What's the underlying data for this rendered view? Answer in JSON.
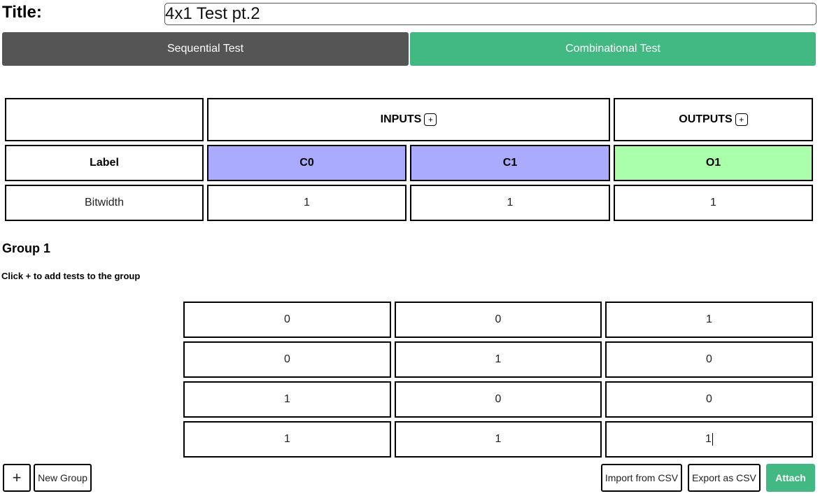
{
  "header": {
    "title_label": "Title:",
    "title_value": "4x1 Test pt.2"
  },
  "modes": {
    "sequential_label": "Sequential Test",
    "combinational_label": "Combinational Test",
    "active": "Combinational Test"
  },
  "table": {
    "inputs_label": "INPUTS",
    "outputs_label": "OUTPUTS",
    "add_symbol": "+",
    "label_row": "Label",
    "bitwidth_row": "Bitwidth",
    "inputs": [
      {
        "name": "C0",
        "bitwidth": "1"
      },
      {
        "name": "C1",
        "bitwidth": "1"
      }
    ],
    "outputs": [
      {
        "name": "O1",
        "bitwidth": "1"
      }
    ]
  },
  "group": {
    "title": "Group 1",
    "hint": "Click + to add tests to the group",
    "rows": [
      [
        "0",
        "0",
        "1"
      ],
      [
        "0",
        "1",
        "0"
      ],
      [
        "1",
        "0",
        "0"
      ],
      [
        "1",
        "1",
        "1"
      ]
    ]
  },
  "footer": {
    "plus_label": "+",
    "new_group_label": "New Group",
    "import_label": "Import from CSV",
    "export_label": "Export as CSV",
    "attach_label": "Attach"
  },
  "colors": {
    "accent_green": "#42b983",
    "inactive_gray": "#555555",
    "input_header": "#aaaaff",
    "output_header": "#aaffaa"
  }
}
